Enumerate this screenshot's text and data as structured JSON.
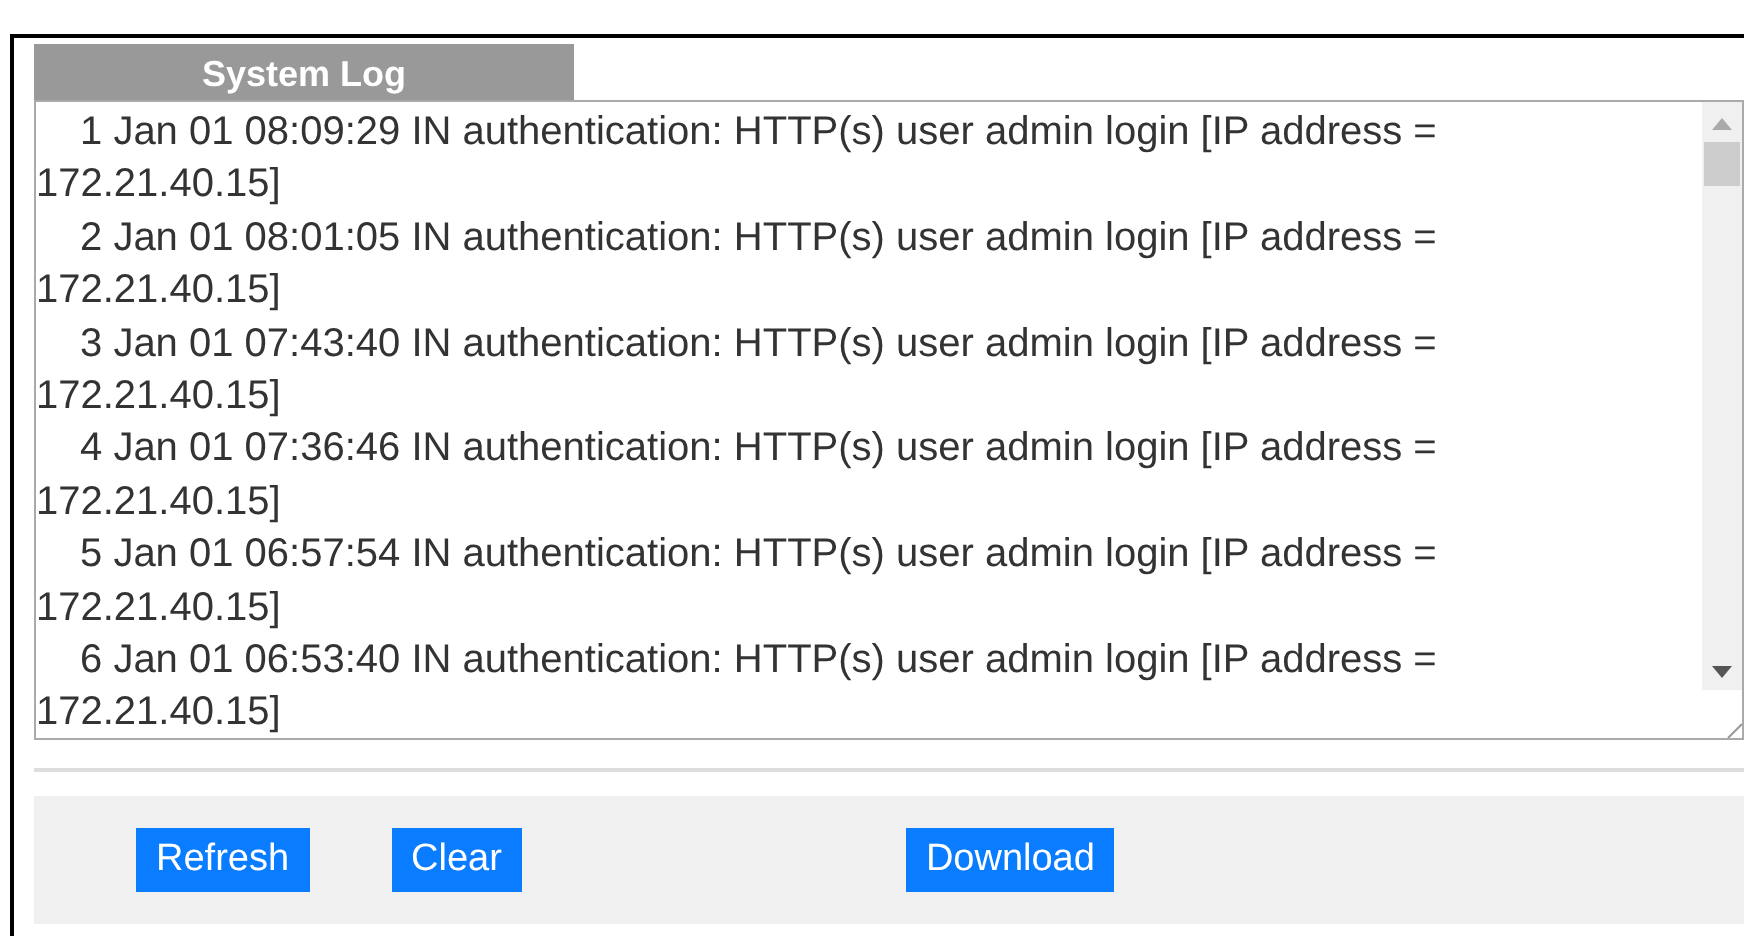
{
  "panel": {
    "tab": "System Log"
  },
  "log": {
    "entries": [
      {
        "number": "1",
        "text": "Jan 01 08:09:29 IN authentication: HTTP(s) user admin login [IP address = 172.21.40.15]"
      },
      {
        "number": "2",
        "text": "Jan 01 08:01:05 IN authentication: HTTP(s) user admin login [IP address = 172.21.40.15]"
      },
      {
        "number": "3",
        "text": "Jan 01 07:43:40 IN authentication: HTTP(s) user admin login [IP address = 172.21.40.15]"
      },
      {
        "number": "4",
        "text": "Jan 01 07:36:46 IN authentication: HTTP(s) user admin login [IP address = 172.21.40.15]"
      },
      {
        "number": "5",
        "text": "Jan 01 06:57:54 IN authentication: HTTP(s) user admin login [IP address = 172.21.40.15]"
      },
      {
        "number": "6",
        "text": "Jan 01 06:53:40 IN authentication: HTTP(s) user admin login [IP address = 172.21.40.15]"
      }
    ]
  },
  "buttons": [
    {
      "label": "Refresh"
    },
    {
      "label": "Clear"
    },
    {
      "label": "Download"
    }
  ]
}
